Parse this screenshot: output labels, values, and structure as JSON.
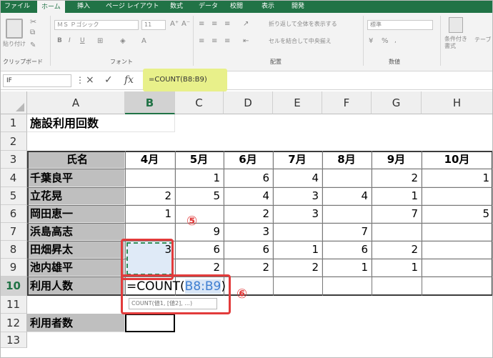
{
  "ribbon": {
    "tabs": [
      "ファイル",
      "ホーム",
      "挿入",
      "ページ レイアウト",
      "数式",
      "データ",
      "校閲",
      "表示",
      "開発"
    ],
    "active_tab": "ホーム",
    "paste_label": "貼り付け",
    "font_name": "ＭＳ Ｐゴシック",
    "font_size": "11",
    "wrap_text": "折り返して全体を表示する",
    "merge_center": "セルを結合して中央揃え",
    "number_format": "標準",
    "conditional_format": "条件付き 書式",
    "table_format": "テーブ",
    "groups": {
      "clipboard": "クリップボード",
      "font": "フォント",
      "alignment": "配置",
      "number": "数値"
    }
  },
  "formula_bar": {
    "name_box": "IF",
    "cancel_icon": "×",
    "enter_icon": "✓",
    "fx_icon": "fx",
    "formula": "=COUNT(B8:B9)"
  },
  "sheet": {
    "columns": [
      "A",
      "B",
      "C",
      "D",
      "E",
      "F",
      "G",
      "H"
    ],
    "rows": [
      "1",
      "2",
      "3",
      "4",
      "5",
      "6",
      "7",
      "8",
      "9",
      "10",
      "11",
      "12",
      "13"
    ],
    "title": "施設利用回数",
    "header_label": "氏名",
    "months": [
      "4月",
      "5月",
      "6月",
      "7月",
      "8月",
      "9月",
      "10月"
    ],
    "people": [
      {
        "name": "千葉良平",
        "values": [
          "",
          "1",
          "6",
          "4",
          "",
          "2",
          "1"
        ]
      },
      {
        "name": "立花晃",
        "values": [
          "2",
          "5",
          "4",
          "3",
          "4",
          "1",
          ""
        ]
      },
      {
        "name": "岡田恵一",
        "values": [
          "1",
          "",
          "2",
          "3",
          "",
          "7",
          "5"
        ]
      },
      {
        "name": "浜島高志",
        "values": [
          "",
          "9",
          "3",
          "",
          "7",
          "",
          ""
        ]
      },
      {
        "name": "田畑昇太",
        "values": [
          "3",
          "6",
          "6",
          "1",
          "6",
          "2",
          ""
        ]
      },
      {
        "name": "池内雄平",
        "values": [
          "",
          "2",
          "2",
          "2",
          "1",
          "1",
          ""
        ]
      }
    ],
    "users_count_label": "利用人数",
    "users_total_label": "利用者数",
    "editing": {
      "prefix": "=COUNT(",
      "ref": "B8:B9",
      "suffix": ")",
      "tooltip": "COUNT(値1, [値2], ...)"
    },
    "callouts": [
      "⑤",
      "⑥"
    ]
  }
}
